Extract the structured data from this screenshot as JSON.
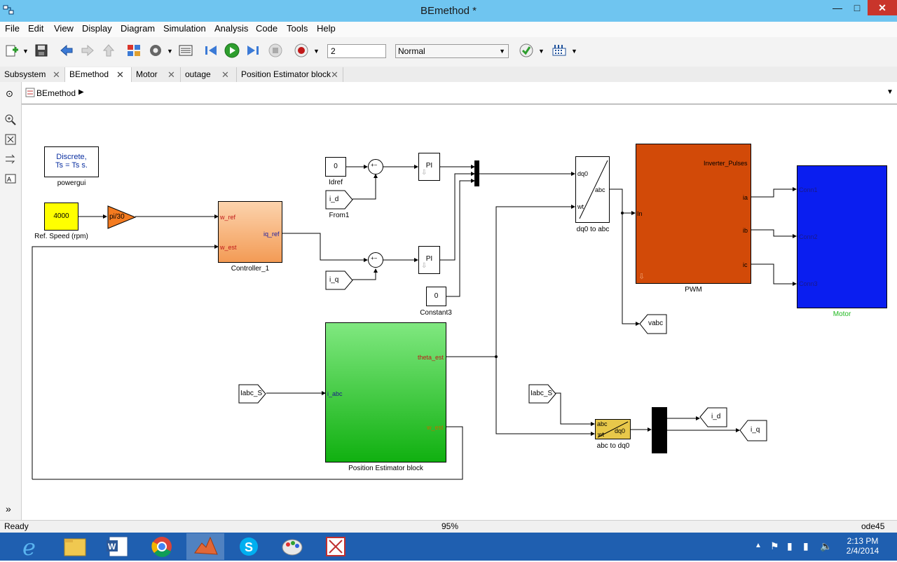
{
  "window": {
    "title": "BEmethod *"
  },
  "menu": [
    "File",
    "Edit",
    "View",
    "Display",
    "Diagram",
    "Simulation",
    "Analysis",
    "Code",
    "Tools",
    "Help"
  ],
  "toolbar": {
    "stop_time": "2",
    "sim_mode": "Normal"
  },
  "tabs": [
    {
      "label": "Subsystem"
    },
    {
      "label": "BEmethod"
    },
    {
      "label": "Motor"
    },
    {
      "label": "outage"
    },
    {
      "label": "Position Estimator block"
    }
  ],
  "breadcrumb": {
    "label": "BEmethod"
  },
  "diagram": {
    "powergui": {
      "line1": "Discrete,",
      "line2": "Ts = Ts s.",
      "name": "powergui"
    },
    "ref_speed": {
      "value": "4000",
      "name": "Ref. Speed (rpm)"
    },
    "gain": {
      "text": "pi/30"
    },
    "controller": {
      "in1": "w_ref",
      "in2": "w_est",
      "out": "iq_ref",
      "name": "Controller_1"
    },
    "idref": {
      "value": "0",
      "name": "Idref"
    },
    "from_id": {
      "text": "i_d",
      "name": "From1"
    },
    "from_iq": {
      "text": "i_q"
    },
    "sum1": {
      "text": "+−"
    },
    "sum2": {
      "text": "+−"
    },
    "pi1": {
      "text": "PI"
    },
    "pi2": {
      "text": "PI"
    },
    "constant3": {
      "value": "0",
      "name": "Constant3"
    },
    "dq0abc": {
      "in1": "dq0",
      "in2": "wt",
      "out": "abc",
      "name": "dq0 to abc"
    },
    "pwm": {
      "in": "In",
      "out0": "Inverter_Pulses",
      "out1": "ia",
      "out2": "ib",
      "out3": "ic",
      "name": "PWM"
    },
    "motor": {
      "in1": "Conn1",
      "in2": "Conn2",
      "in3": "Conn3",
      "name": "Motor"
    },
    "vabc": {
      "text": "vabc"
    },
    "estimator": {
      "in": "i_abc",
      "out1": "theta_est",
      "out2": "w_est",
      "name": "Position Estimator block"
    },
    "iabc1": {
      "text": "Iabc_S"
    },
    "iabc2": {
      "text": "Iabc_S"
    },
    "abcdq0": {
      "in1": "abc",
      "in2": "wt",
      "out": "dq0",
      "name": "abc to dq0"
    },
    "goto_id": {
      "text": "i_d"
    },
    "goto_iq": {
      "text": "i_q"
    }
  },
  "status": {
    "left": "Ready",
    "zoom": "95%",
    "solver": "ode45"
  },
  "clock": {
    "time": "2:13 PM",
    "date": "2/4/2014"
  },
  "colors": {
    "controller": "#f8b47c",
    "pwm": "#d24a08",
    "motor": "#0a1ef0",
    "estimator": "#5fd35f",
    "ref_speed": "#ffff00",
    "gain": "#f47b20",
    "abcdq0": "#e8c84a",
    "motor_label": "#1fb81f"
  }
}
